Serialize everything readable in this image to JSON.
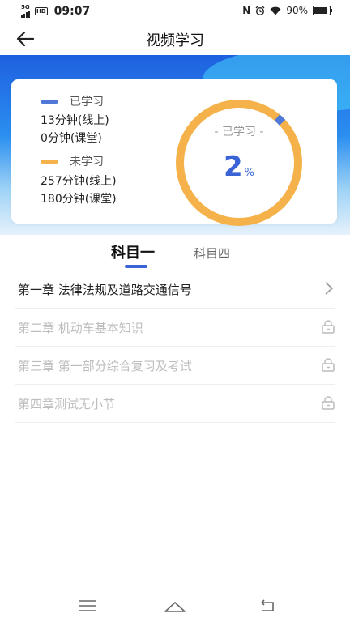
{
  "status_bar": {
    "network": "5G",
    "hd": "HD",
    "time": "09:07",
    "nfc": "N",
    "battery": "90%",
    "battery_level": 0.9
  },
  "header": {
    "title": "视频学习"
  },
  "summary": {
    "studied_label": "已学习",
    "studied_online": "13分钟(线上)",
    "studied_class": "0分钟(课堂)",
    "unstudied_label": "未学习",
    "unstudied_online": "257分钟(线上)",
    "unstudied_class": "180分钟(课堂)",
    "ring_caption": "- 已学习 -",
    "progress_value": "2",
    "progress_unit": "%",
    "progress_fraction": 0.02
  },
  "tabs": [
    {
      "label": "科目一",
      "active": true
    },
    {
      "label": "科目四",
      "active": false
    }
  ],
  "chapters": [
    {
      "label": "第一章 法律法规及道路交通信号",
      "locked": false
    },
    {
      "label": "第二章 机动车基本知识",
      "locked": true
    },
    {
      "label": "第三章 第一部分综合复习及考试",
      "locked": true
    },
    {
      "label": "第四章测试无小节",
      "locked": true
    }
  ],
  "colors": {
    "accent": "#3a63d6",
    "studied": "#4f78d8",
    "unstudied": "#f5b24a",
    "locked_text": "#bdbdbd"
  },
  "icons": [
    "back-arrow-icon",
    "chevron-right-icon",
    "lock-icon",
    "menu-icon",
    "home-icon",
    "back-icon",
    "nfc-icon",
    "alarm-icon",
    "wifi-icon",
    "battery-icon",
    "signal-icon"
  ]
}
